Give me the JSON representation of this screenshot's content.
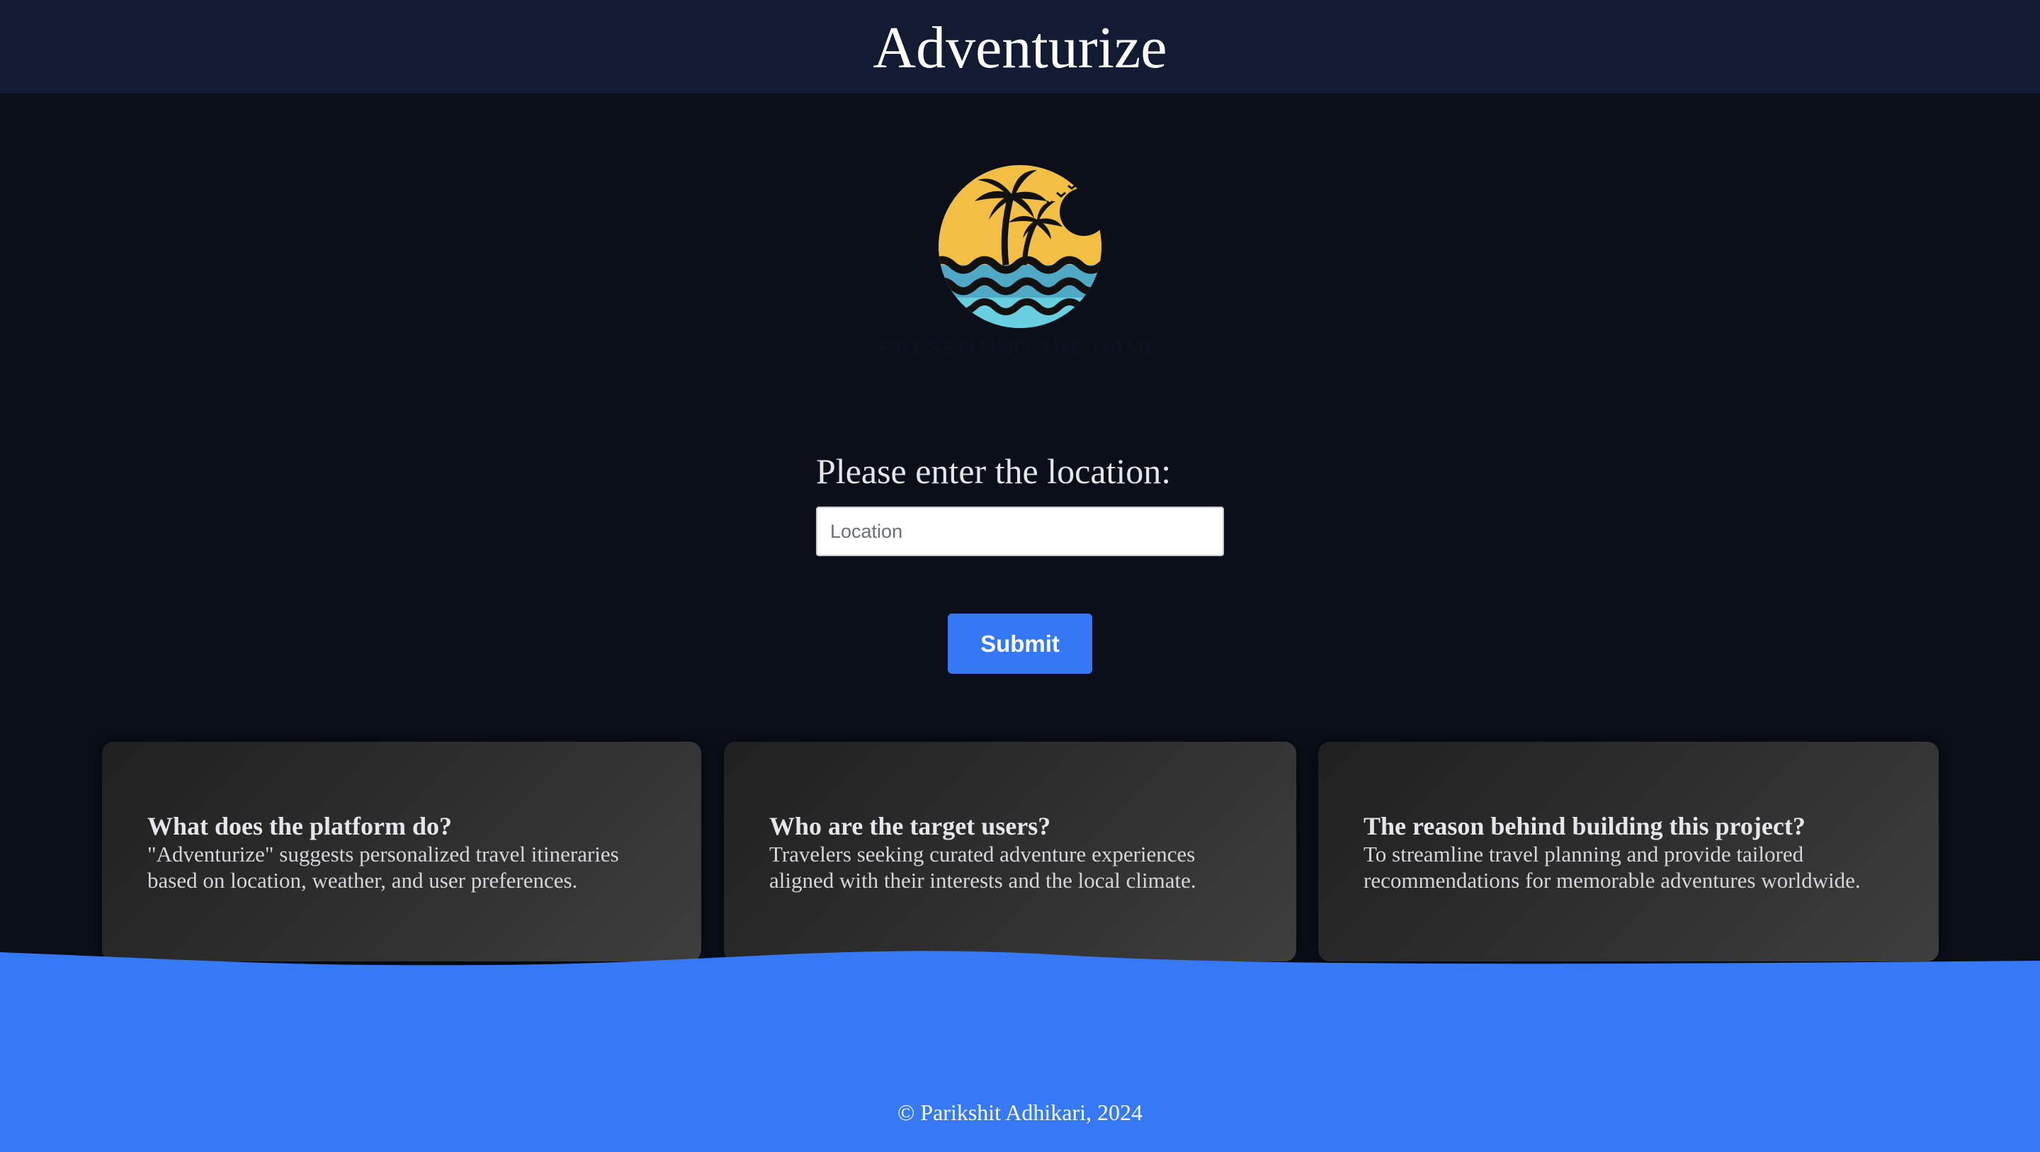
{
  "header": {
    "title": "Adventurize"
  },
  "logo": {
    "icon": "palm-island-sunset-icon",
    "caption": "PRESENTING THE NAME",
    "colors": {
      "sun": "#f2bf44",
      "sea_dark": "#4fa8c4",
      "sea_light": "#67cfe0",
      "silhouette": "#111111"
    }
  },
  "form": {
    "label": "Please enter the location:",
    "input_value": "",
    "input_placeholder": "Location",
    "submit_label": "Submit"
  },
  "cards": [
    {
      "title": "What does the platform do?",
      "body": "\"Adventurize\" suggests personalized travel itineraries based on location, weather, and user preferences."
    },
    {
      "title": "Who are the target users?",
      "body": "Travelers seeking curated adventure experiences aligned with their interests and the local climate."
    },
    {
      "title": "The reason behind building this project?",
      "body": "To streamline travel planning and provide tailored recommendations for memorable adventures worldwide."
    }
  ],
  "footer": {
    "text": "© Parikshit Adhikari, 2024"
  },
  "colors": {
    "background": "#0a0f1a",
    "header": "#121b31",
    "accent": "#3478f6",
    "footer": "#3579f6"
  }
}
